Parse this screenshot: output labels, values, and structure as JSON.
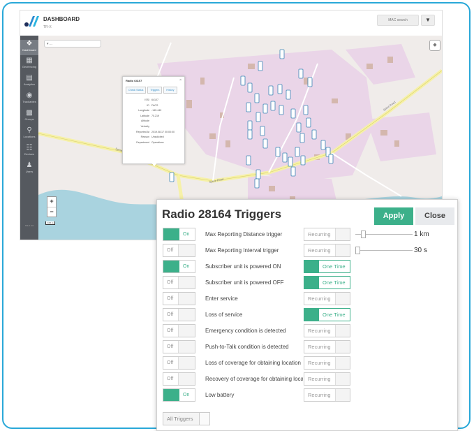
{
  "colors": {
    "frame": "#29a8d8",
    "accent": "#3cb08a",
    "sidebar": "#55595f",
    "water": "#a9d3df",
    "area": "#ead5e8",
    "road": "#f6f1a8"
  },
  "dashboard": {
    "title": "DASHBOARD",
    "subtitle": "TR-X",
    "mac_search": "MAC search",
    "filter_icon": "filter-icon",
    "sidebar": [
      {
        "label": "Dashboard",
        "icon": "dashboard-icon"
      },
      {
        "label": "Geofencing",
        "icon": "geofence-icon"
      },
      {
        "label": "Analytics",
        "icon": "analytics-icon"
      },
      {
        "label": "Trackables",
        "icon": "trackables-icon"
      },
      {
        "label": "Groups",
        "icon": "groups-icon"
      },
      {
        "label": "Locations",
        "icon": "location-icon"
      },
      {
        "label": "Devices",
        "icon": "devices-icon"
      },
      {
        "label": "Users",
        "icon": "users-icon"
      }
    ],
    "sidebar_footer": "TR-X 3.0",
    "map": {
      "select_placeholder": "▾  ...",
      "zoom_in": "+",
      "zoom_out": "−",
      "scale": "100 m",
      "road_labels": [
        "Spine Road",
        "Spine Road",
        "Spine Road"
      ],
      "popup": {
        "title": "Radio 64107",
        "close": "×",
        "tabs": [
          "Check Status",
          "Triggers",
          "History"
        ],
        "rows": [
          {
            "k": "ISSI",
            "v": "64107"
          },
          {
            "k": "ID",
            "v": "FACS"
          },
          {
            "k": "Longitude",
            "v": "-145.440"
          },
          {
            "k": "Latitude",
            "v": "70.219"
          },
          {
            "k": "Altitude",
            "v": ""
          },
          {
            "k": "Velocity",
            "v": ""
          },
          {
            "k": "Reported At",
            "v": "2019.08.17 00:00:00"
          },
          {
            "k": "Reason",
            "v": "Unsolicited"
          },
          {
            "k": "Department",
            "v": "Operations"
          }
        ]
      }
    }
  },
  "panel": {
    "title": "Radio 28164 Triggers",
    "apply": "Apply",
    "close": "Close",
    "triggers": [
      {
        "state": "On",
        "on": true,
        "name": "Max Reporting Distance trigger",
        "mode": "Recurring",
        "one_time": false,
        "slider_value": "1 km",
        "slider_level": 0.1
      },
      {
        "state": "Off",
        "on": false,
        "name": "Max Reporting Interval trigger",
        "mode": "Recurring",
        "one_time": false,
        "slider_value": "30 s",
        "slider_level": 0.0
      },
      {
        "state": "On",
        "on": true,
        "name": "Subscriber unit is powered ON",
        "mode": "One Time",
        "one_time": true
      },
      {
        "state": "Off",
        "on": false,
        "name": "Subscriber unit is powered OFF",
        "mode": "One Time",
        "one_time": true
      },
      {
        "state": "Off",
        "on": false,
        "name": "Enter service",
        "mode": "Recurring",
        "one_time": false
      },
      {
        "state": "Off",
        "on": false,
        "name": "Loss of service",
        "mode": "One Time",
        "one_time": true
      },
      {
        "state": "Off",
        "on": false,
        "name": "Emergency condition is detected",
        "mode": "Recurring",
        "one_time": false
      },
      {
        "state": "Off",
        "on": false,
        "name": "Push-to-Talk condition is detected",
        "mode": "Recurring",
        "one_time": false
      },
      {
        "state": "Off",
        "on": false,
        "name": "Loss of coverage for obtaining location",
        "mode": "Recurring",
        "one_time": false
      },
      {
        "state": "Off",
        "on": false,
        "name": "Recovery of coverage for obtaining location",
        "mode": "Recurring",
        "one_time": false
      },
      {
        "state": "On",
        "on": true,
        "name": "Low battery",
        "mode": "Recurring",
        "one_time": false
      }
    ],
    "all_triggers": "All Triggers"
  }
}
